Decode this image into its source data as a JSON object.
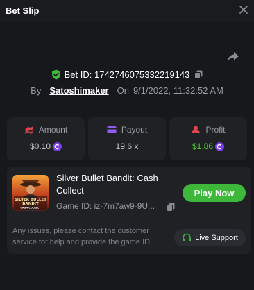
{
  "header": {
    "title": "Bet Slip"
  },
  "bet": {
    "id_label": "Bet ID: 1742746075332219143",
    "by": "By",
    "user": "Satoshimaker",
    "on": "On",
    "date": "9/1/2022, 11:32:52 AM"
  },
  "stats": {
    "amount": {
      "label": "Amount",
      "value": "$0.10"
    },
    "payout": {
      "label": "Payout",
      "value": "19.6 x"
    },
    "profit": {
      "label": "Profit",
      "value": "$1.86"
    }
  },
  "game": {
    "title": "Silver Bullet Bandit: Cash Collect",
    "game_id": "Game ID: iz-7m7aw9-9U...",
    "play_label": "Play Now",
    "thumb_text_1": "SILVER BULLET",
    "thumb_text_2": "BANDIT",
    "thumb_text_3": "CASH COLLECT"
  },
  "help": {
    "issues_text": "Any issues, please contact the customer service for help and provide the game ID.",
    "support_label": "Live Support"
  },
  "colors": {
    "accent_green": "#3db83a",
    "profit_green": "#55c636",
    "coin_purple": "#7b3fe4",
    "amount_icon": "#e0444c",
    "payout_icon": "#8f5cf0",
    "profit_icon": "#e0444c"
  },
  "icons": [
    "close-icon",
    "share-icon",
    "shield-check-icon",
    "copy-icon",
    "amount-icon",
    "payout-icon",
    "profit-icon",
    "coin-icon",
    "headset-icon"
  ]
}
